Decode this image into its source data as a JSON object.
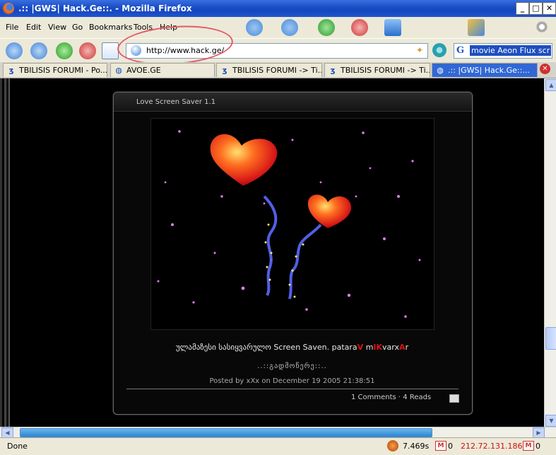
{
  "window": {
    "title": ".:: |GWS| Hack.Ge::. - Mozilla Firefox"
  },
  "menu": {
    "file": "File",
    "edit": "Edit",
    "view": "View",
    "go": "Go",
    "bookmarks": "Bookmarks",
    "tools": "Tools",
    "help": "Help"
  },
  "address": {
    "url": "http://www.hack.ge/"
  },
  "search": {
    "query": "movie Aeon Flux scr"
  },
  "tabs": [
    {
      "label": "TBILISIS FORUMI - Po..."
    },
    {
      "label": "AVOE.GE"
    },
    {
      "label": "TBILISIS FORUMI -> Ti..."
    },
    {
      "label": "TBILISIS FORUMI -> Ti..."
    },
    {
      "label": ".:: |GWS| Hack.Ge::..."
    }
  ],
  "article": {
    "title": "Love Screen Saver 1.1",
    "caption_prefix": "ულამაზესი სასიყვარულო Screen Saven. patara",
    "c1": "V",
    "c2": " m",
    "c3": "IK",
    "c4": "varx",
    "c5": "A",
    "c6": "r",
    "read_more": "..::გადმოწერე::..",
    "posted": "Posted by xXx on December 19 2005 21:38:51",
    "comments": "1 Comments · 4 Reads"
  },
  "status": {
    "done": "Done",
    "time": "7.469s",
    "mail1": "0",
    "ip": "212.72.131.186",
    "mail2": "0"
  },
  "colors": {
    "accent_red": "#e01010",
    "titlebar": "#1c4fc8",
    "ip_red": "#d01010"
  }
}
